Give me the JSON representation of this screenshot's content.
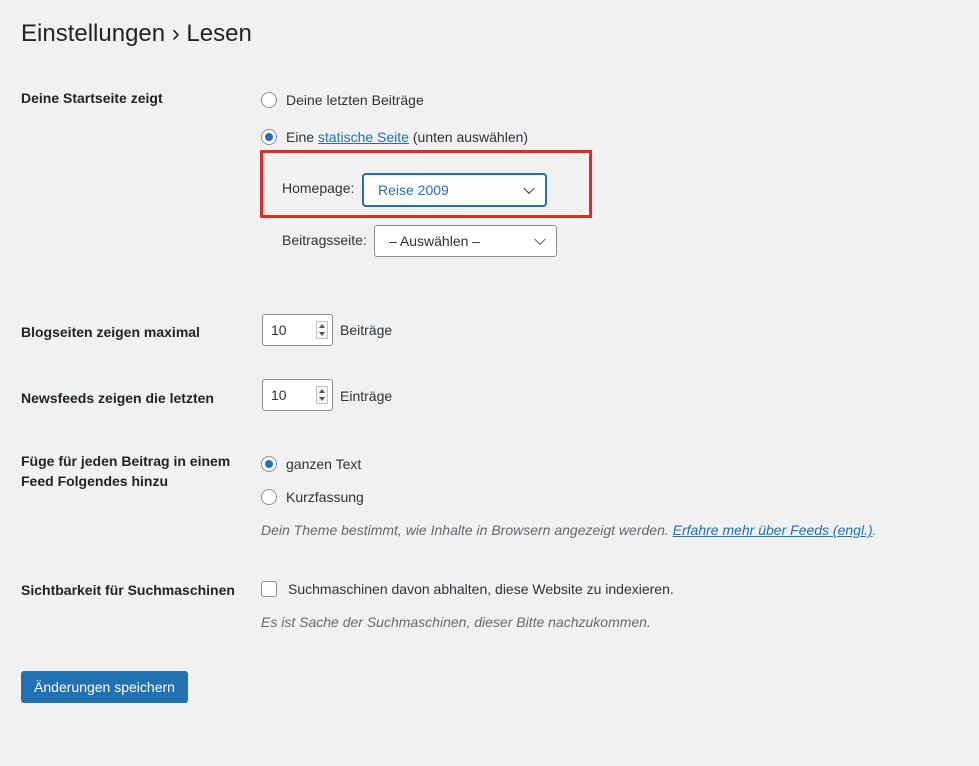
{
  "page": {
    "title": "Einstellungen › Lesen"
  },
  "homepage_display": {
    "label": "Deine Startseite zeigt",
    "option_latest": "Deine letzten Beiträge",
    "option_static_prefix": "Eine",
    "option_static_link": "statische Seite",
    "option_static_suffix": "(unten auswählen)",
    "selected": "static",
    "homepage_label": "Homepage:",
    "homepage_value": "Reise 2009",
    "posts_page_label": "Beitragsseite:",
    "posts_page_value": "– Auswählen –"
  },
  "blog_pages": {
    "label": "Blogseiten zeigen maximal",
    "value": "10",
    "unit": "Beiträge"
  },
  "feeds": {
    "label": "Newsfeeds zeigen die letzten",
    "value": "10",
    "unit": "Einträge"
  },
  "feed_content": {
    "label_line1": "Füge für jeden Beitrag in einem",
    "label_line2": "Feed Folgendes hinzu",
    "option_full": "ganzen Text",
    "option_excerpt": "Kurzfassung",
    "selected": "full",
    "description": "Dein Theme bestimmt, wie Inhalte in Browsern angezeigt werden.",
    "description_link": "Erfahre mehr über Feeds (engl.)",
    "description_end": "."
  },
  "search_visibility": {
    "label": "Sichtbarkeit für Suchmaschinen",
    "checkbox_label": "Suchmaschinen davon abhalten, diese Website zu indexieren.",
    "checked": false,
    "description": "Es ist Sache der Suchmaschinen, dieser Bitte nachzukommen."
  },
  "actions": {
    "save_label": "Änderungen speichern"
  },
  "colors": {
    "accent": "#2271b1",
    "highlight_box": "#e02b20",
    "background": "#f1f1f1"
  }
}
